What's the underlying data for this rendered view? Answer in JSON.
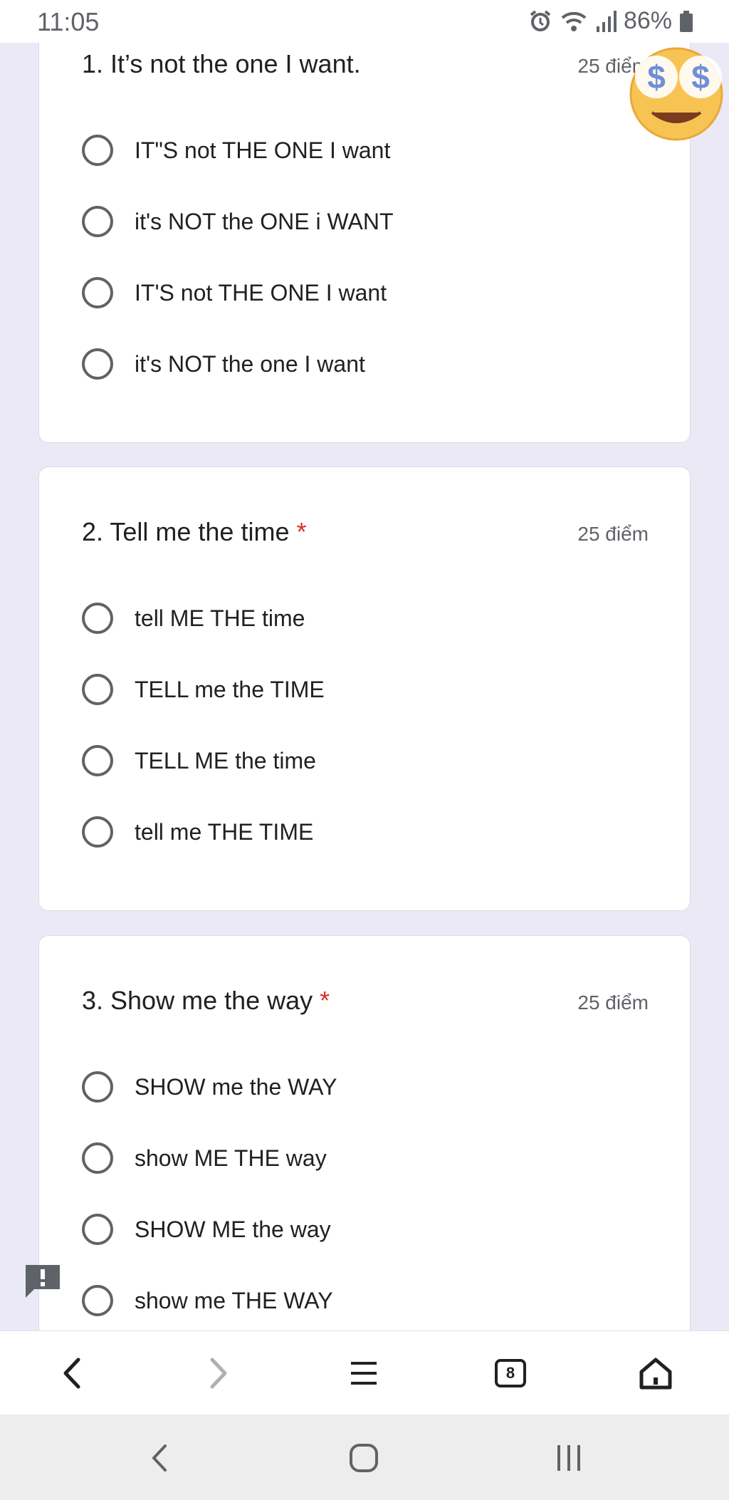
{
  "status_bar": {
    "time": "11:05",
    "battery": "86%",
    "icons": [
      "alarm-icon",
      "wifi-icon",
      "signal-icon",
      "battery-icon"
    ]
  },
  "questions": [
    {
      "title": "1. It’s not the one I want.",
      "required": false,
      "points": "25 điểm",
      "options": [
        "IT\"S not THE ONE I want",
        "it's NOT the ONE i WANT",
        "IT'S not THE ONE I want",
        "it's NOT the one I want"
      ]
    },
    {
      "title": "2. Tell me the time",
      "required": true,
      "required_mark": "*",
      "points": "25 điểm",
      "options": [
        "tell ME THE time",
        "TELL me the TIME",
        "TELL ME the time",
        "tell me THE TIME"
      ]
    },
    {
      "title": "3. Show me the way",
      "required": true,
      "required_mark": "*",
      "points": "25 điểm",
      "options": [
        "SHOW me the WAY",
        "show ME THE way",
        "SHOW ME the way",
        "show me THE WAY"
      ]
    }
  ],
  "browser_bar": {
    "tab_count": "8",
    "icons": [
      "back-icon",
      "forward-icon",
      "menu-icon",
      "tabs-icon",
      "home-icon"
    ]
  },
  "system_nav": {
    "icons": [
      "back-icon",
      "home-icon",
      "recents-icon"
    ]
  },
  "colors": {
    "page_background": "#ece9f7",
    "required": "#d93025",
    "radio": "#5f6368"
  }
}
